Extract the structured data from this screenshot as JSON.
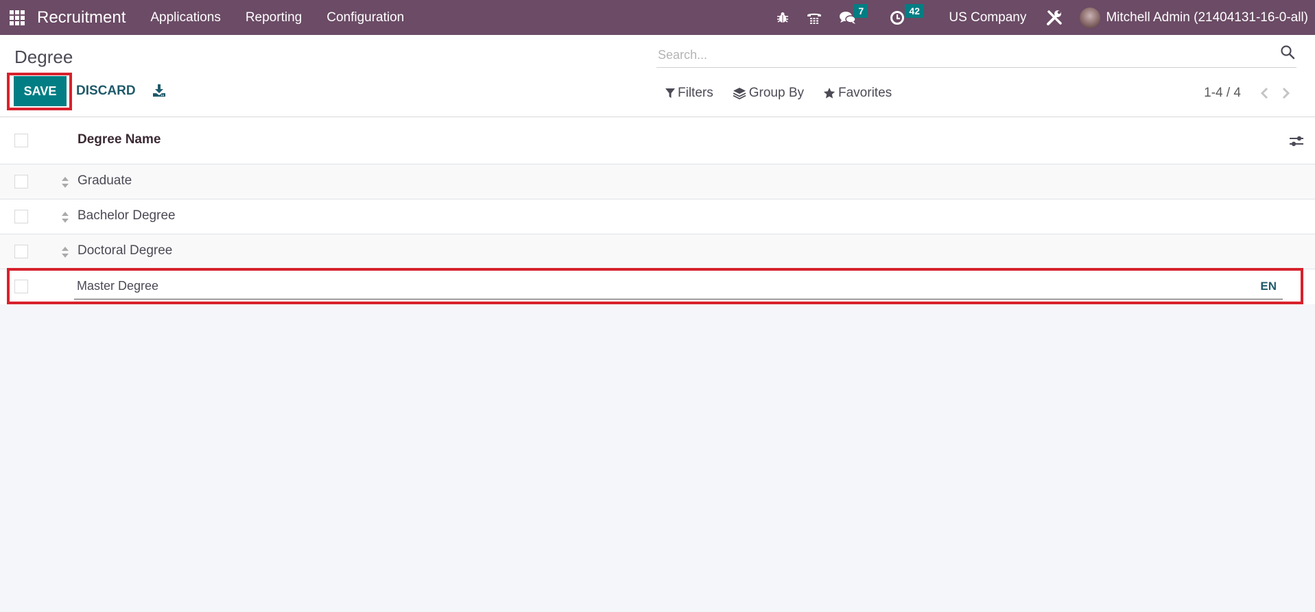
{
  "navbar": {
    "app_name": "Recruitment",
    "menu": [
      "Applications",
      "Reporting",
      "Configuration"
    ],
    "messages_count": "7",
    "activities_count": "42",
    "company": "US Company",
    "user": "Mitchell Admin (21404131-16-0-all)",
    "icons": [
      "apps-grid-icon",
      "bug-icon",
      "phone-icon",
      "chat-icon",
      "clock-icon",
      "tools-icon"
    ]
  },
  "control_panel": {
    "title": "Degree",
    "save_label": "SAVE",
    "discard_label": "DISCARD",
    "search_placeholder": "Search...",
    "filters_label": "Filters",
    "group_by_label": "Group By",
    "favorites_label": "Favorites",
    "pager": "1-4 / 4"
  },
  "list": {
    "column_header": "Degree Name",
    "rows": [
      {
        "name": "Graduate"
      },
      {
        "name": "Bachelor Degree"
      },
      {
        "name": "Doctoral Degree"
      }
    ],
    "editing_row": {
      "value": "Master Degree",
      "lang": "EN"
    }
  },
  "colors": {
    "navbar": "#6b4b65",
    "primary": "#017e84",
    "highlight": "#d7222d"
  }
}
